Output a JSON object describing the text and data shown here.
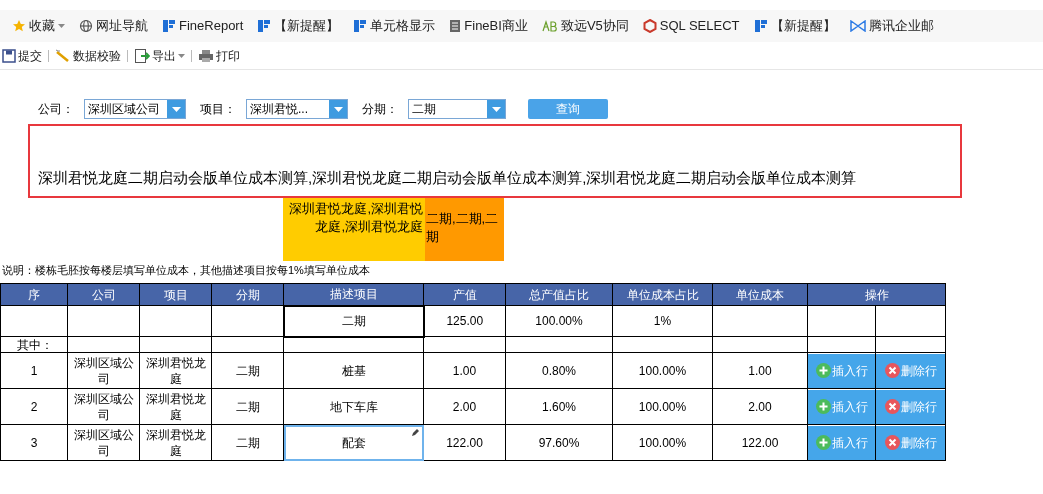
{
  "bookmarks": [
    {
      "label": "收藏",
      "kind": "star",
      "dropdown": true
    },
    {
      "label": "网址导航",
      "kind": "globe",
      "dropdown": false
    },
    {
      "label": "FineReport",
      "kind": "fr",
      "dropdown": false
    },
    {
      "label": "【新提醒】",
      "kind": "fr",
      "dropdown": false
    },
    {
      "label": "单元格显示",
      "kind": "fr",
      "dropdown": false
    },
    {
      "label": "FineBI商业",
      "kind": "doc",
      "dropdown": false
    },
    {
      "label": "致远V5协同",
      "kind": "ab",
      "dropdown": false
    },
    {
      "label": "SQL SELECT",
      "kind": "sql",
      "dropdown": false
    },
    {
      "label": "【新提醒】",
      "kind": "fr",
      "dropdown": false
    },
    {
      "label": "腾讯企业邮",
      "kind": "mail",
      "dropdown": false
    }
  ],
  "toolbar": [
    {
      "label": "提交",
      "kind": "save",
      "dropdown": false
    },
    {
      "label": "数据校验",
      "kind": "wand",
      "dropdown": false
    },
    {
      "label": "导出",
      "kind": "export",
      "dropdown": true
    },
    {
      "label": "打印",
      "kind": "print",
      "dropdown": false
    }
  ],
  "filters": [
    {
      "label": "公司：",
      "value": "深圳区域公司"
    },
    {
      "label": "项目：",
      "value": "深圳君悦..."
    },
    {
      "label": "分期：",
      "value": "二期"
    }
  ],
  "query_button": "查询",
  "highlight_text": "深圳君悦龙庭二期启动会版单位成本测算,深圳君悦龙庭二期启动会版单位成本测算,深圳君悦龙庭二期启动会版单位成本测算",
  "project_cell": "深圳君悦龙庭,深圳君悦龙庭,深圳君悦龙庭",
  "phase_cell": "二期,二期,二期",
  "note": "说明：楼栋毛胚按每楼层填写单位成本，其他描述项目按每1%填写单位成本",
  "table": {
    "columns": [
      "序",
      "公司",
      "项目",
      "分期",
      "描述项目",
      "产值",
      "总产值占比",
      "单位成本占比",
      "单位成本",
      "操作"
    ],
    "rows": [
      {
        "kind": "total",
        "description": "二期",
        "output": "125.00",
        "share": "100.00%",
        "unit_share": "1%"
      },
      {
        "kind": "label",
        "index": "其中："
      },
      {
        "kind": "item",
        "index": "1",
        "company": "深圳区域公司",
        "project": "深圳君悦龙庭",
        "phase": "二期",
        "description": "桩基",
        "output": "1.00",
        "share": "0.80%",
        "unit_share": "100.00%",
        "unit_cost": "1.00",
        "insert": "插入行",
        "delete": "删除行",
        "selected": false
      },
      {
        "kind": "item",
        "index": "2",
        "company": "深圳区域公司",
        "project": "深圳君悦龙庭",
        "phase": "二期",
        "description": "地下车库",
        "output": "2.00",
        "share": "1.60%",
        "unit_share": "100.00%",
        "unit_cost": "2.00",
        "insert": "插入行",
        "delete": "删除行",
        "selected": false
      },
      {
        "kind": "item",
        "index": "3",
        "company": "深圳区域公司",
        "project": "深圳君悦龙庭",
        "phase": "二期",
        "description": "配套",
        "output": "122.00",
        "share": "97.60%",
        "unit_share": "100.00%",
        "unit_cost": "122.00",
        "insert": "插入行",
        "delete": "删除行",
        "selected": true
      }
    ]
  }
}
